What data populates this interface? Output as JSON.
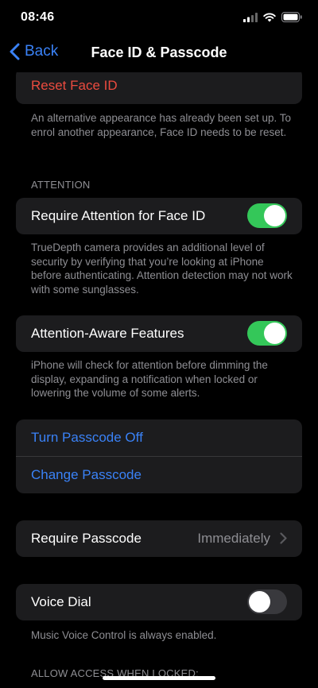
{
  "status": {
    "time": "08:46"
  },
  "nav": {
    "back_label": "Back",
    "title": "Face ID & Passcode"
  },
  "face_id": {
    "reset_label": "Reset Face ID",
    "reset_footnote": "An alternative appearance has already been set up. To enrol another appearance, Face ID needs to be reset."
  },
  "attention": {
    "header": "ATTENTION",
    "require_label": "Require Attention for Face ID",
    "require_on": true,
    "require_footnote": "TrueDepth camera provides an additional level of security by verifying that you’re looking at iPhone before authenticating. Attention detection may not work with some sunglasses.",
    "aware_label": "Attention-Aware Features",
    "aware_on": true,
    "aware_footnote": "iPhone will check for attention before dimming the display, expanding a notification when locked or lowering the volume of some alerts."
  },
  "passcode": {
    "turn_off_label": "Turn Passcode Off",
    "change_label": "Change Passcode",
    "require_label": "Require Passcode",
    "require_value": "Immediately"
  },
  "voice_dial": {
    "label": "Voice Dial",
    "on": false,
    "footnote": "Music Voice Control is always enabled."
  },
  "locked_access": {
    "header": "ALLOW ACCESS WHEN LOCKED:"
  },
  "colors": {
    "accent_blue": "#3a82f7",
    "destructive_red": "#eb4b3f",
    "toggle_green": "#34c759"
  }
}
